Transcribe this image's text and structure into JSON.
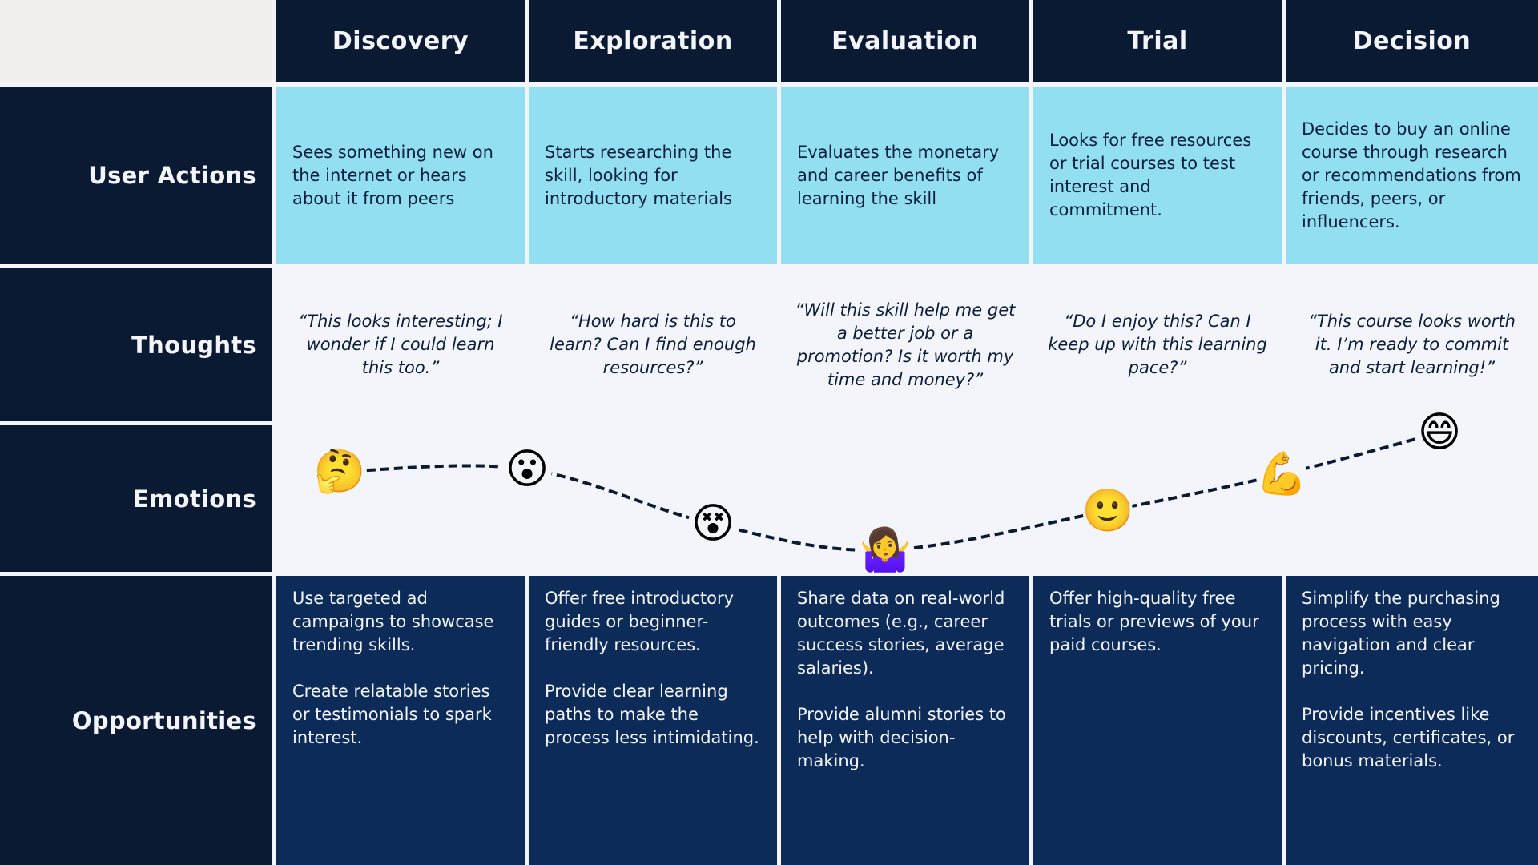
{
  "stages": [
    {
      "name": "Discovery",
      "action": "Sees something new on the internet or hears about it from peers",
      "thought": "“This looks interesting; I wonder if I could learn this too.”",
      "opportunities": [
        "Use targeted ad campaigns to showcase trending skills.",
        "Create relatable stories or testimonials to spark interest."
      ]
    },
    {
      "name": "Exploration",
      "action": "Starts researching the skill, looking for introductory materials",
      "thought": "“How hard is this to learn? Can I find enough resources?”",
      "opportunities": [
        "Offer free introductory guides or beginner-friendly resources.",
        "Provide clear learning paths to make the process less intimidating."
      ]
    },
    {
      "name": "Evaluation",
      "action": "Evaluates the monetary and career benefits of learning the skill",
      "thought": "“Will this skill help me get a better job or a promotion? Is it worth my time and money?”",
      "opportunities": [
        "Share data on real-world outcomes (e.g., career success stories, average salaries).",
        "Provide alumni stories to help with decision-making."
      ]
    },
    {
      "name": "Trial",
      "action": "Looks for free resources or trial courses to test interest and commitment.",
      "thought": "“Do I enjoy this? Can I keep up with this learning pace?”",
      "opportunities": [
        "Offer high-quality free trials or previews of your paid courses."
      ]
    },
    {
      "name": "Decision",
      "action": "Decides to buy an online course through research or recommendations from friends, peers, or influencers.",
      "thought": "“This course looks worth it. I’m ready to commit and start learning!”",
      "opportunities": [
        "Simplify the purchasing process with easy navigation and clear pricing.",
        "Provide incentives like discounts, certificates, or bonus materials."
      ]
    }
  ],
  "row_labels": {
    "actions": "User Actions",
    "thoughts": "Thoughts",
    "emotions": "Emotions",
    "opportunities": "Opportunities"
  },
  "emotions": [
    {
      "icon": "thinking-face-icon",
      "glyph": "🤔",
      "level": 0.7
    },
    {
      "icon": "surprised-face-icon",
      "glyph": "😮",
      "level": 0.72
    },
    {
      "icon": "dizzy-face-icon",
      "glyph": "😵",
      "level": 0.3
    },
    {
      "icon": "shrugging-woman-icon",
      "glyph": "🤷‍♀️",
      "level": 0.1
    },
    {
      "icon": "smiling-face-icon",
      "glyph": "🙂",
      "level": 0.4
    },
    {
      "icon": "flexed-biceps-icon",
      "glyph": "💪",
      "level": 0.68
    },
    {
      "icon": "grinning-face-icon",
      "glyph": "😄",
      "level": 1.0
    }
  ],
  "colors": {
    "header_bg": "#0b1a33",
    "actions_bg": "#92dff2",
    "thoughts_bg": "#f4f5fa",
    "opportunities_bg": "#0c2b59",
    "curve": "#0b1a33"
  }
}
